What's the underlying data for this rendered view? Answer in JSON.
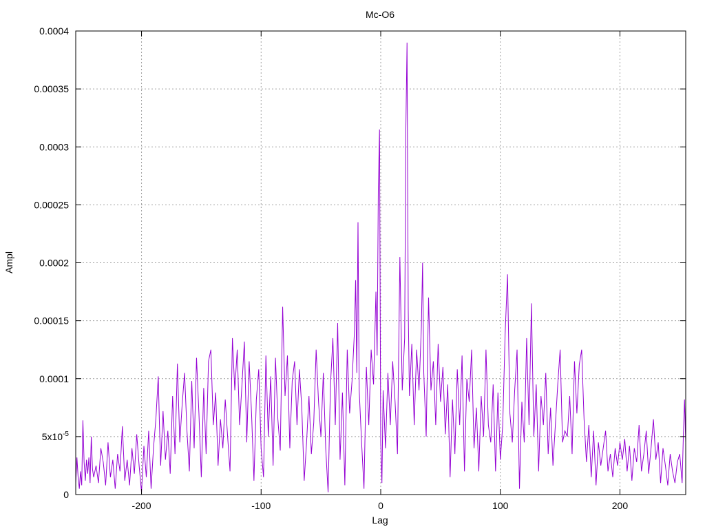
{
  "chart_data": {
    "type": "line",
    "title": "Mc-O6",
    "xlabel": "Lag",
    "ylabel": "Ampl",
    "xlim": [
      -255,
      255
    ],
    "ylim": [
      0,
      0.0004
    ],
    "grid": true,
    "legend": "none",
    "x_ticks": [
      {
        "value": -200,
        "label": "-200"
      },
      {
        "value": -100,
        "label": "-100"
      },
      {
        "value": 0,
        "label": "0"
      },
      {
        "value": 100,
        "label": "100"
      },
      {
        "value": 200,
        "label": "200"
      }
    ],
    "y_ticks": [
      {
        "value": 0,
        "label": "0"
      },
      {
        "value": 5e-05,
        "label": "5x10",
        "sup": "-5"
      },
      {
        "value": 0.0001,
        "label": "0.0001"
      },
      {
        "value": 0.00015,
        "label": "0.00015"
      },
      {
        "value": 0.0002,
        "label": "0.0002"
      },
      {
        "value": 0.00025,
        "label": "0.00025"
      },
      {
        "value": 0.0003,
        "label": "0.0003"
      },
      {
        "value": 0.00035,
        "label": "0.00035"
      },
      {
        "value": 0.0004,
        "label": "0.0004"
      }
    ],
    "series": [
      {
        "color": "#9400d3",
        "points": [
          [
            -255,
            1e-05
          ],
          [
            -254,
            3.2e-05
          ],
          [
            -253,
            1.5e-05
          ],
          [
            -252,
            5e-06
          ],
          [
            -251,
            2e-05
          ],
          [
            -250,
            8e-06
          ],
          [
            -249,
            6.4e-05
          ],
          [
            -248,
            2.8e-05
          ],
          [
            -247,
            1.2e-05
          ],
          [
            -246,
            3e-05
          ],
          [
            -245,
            1.8e-05
          ],
          [
            -244,
            3.2e-05
          ],
          [
            -243,
            1e-05
          ],
          [
            -242,
            5e-05
          ],
          [
            -241,
            2.2e-05
          ],
          [
            -240,
            1.5e-05
          ],
          [
            -238,
            2.5e-05
          ],
          [
            -236,
            1e-05
          ],
          [
            -234,
            4e-05
          ],
          [
            -232,
            2.8e-05
          ],
          [
            -230,
            8e-06
          ],
          [
            -228,
            4.5e-05
          ],
          [
            -226,
            1.5e-05
          ],
          [
            -224,
            3e-05
          ],
          [
            -222,
            5e-06
          ],
          [
            -220,
            3.5e-05
          ],
          [
            -218,
            2e-05
          ],
          [
            -216,
            5.9e-05
          ],
          [
            -214,
            1.2e-05
          ],
          [
            -212,
            3e-05
          ],
          [
            -210,
            8e-06
          ],
          [
            -208,
            4e-05
          ],
          [
            -206,
            1.8e-05
          ],
          [
            -204,
            5.2e-05
          ],
          [
            -202,
            2.5e-05
          ],
          [
            -200,
            2e-06
          ],
          [
            -198,
            4.2e-05
          ],
          [
            -196,
            1.5e-05
          ],
          [
            -194,
            5.5e-05
          ],
          [
            -192,
            5e-06
          ],
          [
            -190,
            4e-05
          ],
          [
            -188,
            6.5e-05
          ],
          [
            -186,
            0.000102
          ],
          [
            -185,
            6e-05
          ],
          [
            -184,
            2.5e-05
          ],
          [
            -182,
            7.2e-05
          ],
          [
            -180,
            3e-05
          ],
          [
            -178,
            5.5e-05
          ],
          [
            -176,
            1.8e-05
          ],
          [
            -174,
            8.5e-05
          ],
          [
            -172,
            3.5e-05
          ],
          [
            -170,
            0.000113
          ],
          [
            -168,
            4.5e-05
          ],
          [
            -166,
            7.8e-05
          ],
          [
            -164,
            0.000105
          ],
          [
            -162,
            5.5e-05
          ],
          [
            -160,
            2e-05
          ],
          [
            -158,
            9.8e-05
          ],
          [
            -156,
            4e-05
          ],
          [
            -154,
            0.000118
          ],
          [
            -152,
            7e-05
          ],
          [
            -150,
            1.5e-05
          ],
          [
            -148,
            9.2e-05
          ],
          [
            -146,
            3.5e-05
          ],
          [
            -144,
            0.000115
          ],
          [
            -142,
            0.000125
          ],
          [
            -140,
            6e-05
          ],
          [
            -138,
            8.8e-05
          ],
          [
            -136,
            2.5e-05
          ],
          [
            -134,
            6.5e-05
          ],
          [
            -132,
            4e-05
          ],
          [
            -130,
            8.2e-05
          ],
          [
            -128,
            5e-05
          ],
          [
            -126,
            2e-05
          ],
          [
            -124,
            0.000135
          ],
          [
            -122,
            9e-05
          ],
          [
            -120,
            0.000125
          ],
          [
            -118,
            6e-05
          ],
          [
            -116,
            9.5e-05
          ],
          [
            -114,
            0.000132
          ],
          [
            -112,
            4.5e-05
          ],
          [
            -110,
            0.000115
          ],
          [
            -108,
            7e-05
          ],
          [
            -106,
            1.2e-05
          ],
          [
            -104,
            8.2e-05
          ],
          [
            -102,
            0.000108
          ],
          [
            -100,
            4e-05
          ],
          [
            -98,
            1.5e-05
          ],
          [
            -96,
            0.00012
          ],
          [
            -94,
            5e-05
          ],
          [
            -92,
            0.000102
          ],
          [
            -90,
            2.5e-05
          ],
          [
            -88,
            0.000118
          ],
          [
            -86,
            6.5e-05
          ],
          [
            -84,
            3.8e-05
          ],
          [
            -82,
            0.000162
          ],
          [
            -80,
            8.5e-05
          ],
          [
            -78,
            0.00012
          ],
          [
            -76,
            4e-05
          ],
          [
            -74,
            9.8e-05
          ],
          [
            -72,
            0.000115
          ],
          [
            -70,
            6e-05
          ],
          [
            -68,
            0.000108
          ],
          [
            -66,
            7.5e-05
          ],
          [
            -64,
            1.2e-05
          ],
          [
            -62,
            4.5e-05
          ],
          [
            -60,
            8.5e-05
          ],
          [
            -58,
            3.5e-05
          ],
          [
            -56,
            6.2e-05
          ],
          [
            -54,
            0.000125
          ],
          [
            -52,
            8e-05
          ],
          [
            -50,
            5e-05
          ],
          [
            -48,
            0.000105
          ],
          [
            -46,
            4e-05
          ],
          [
            -44,
            2e-06
          ],
          [
            -42,
            9.5e-05
          ],
          [
            -40,
            0.000135
          ],
          [
            -38,
            6e-05
          ],
          [
            -36,
            0.000148
          ],
          [
            -34,
            3e-05
          ],
          [
            -32,
            8.8e-05
          ],
          [
            -30,
            8e-06
          ],
          [
            -28,
            0.000125
          ],
          [
            -26,
            7e-05
          ],
          [
            -24,
            9.8e-05
          ],
          [
            -22,
            0.00014
          ],
          [
            -21,
            0.000185
          ],
          [
            -20,
            0.000105
          ],
          [
            -19,
            0.000235
          ],
          [
            -18,
            9e-05
          ],
          [
            -16,
            4.5e-05
          ],
          [
            -14,
            5e-06
          ],
          [
            -12,
            0.00011
          ],
          [
            -10,
            6e-05
          ],
          [
            -8,
            0.000125
          ],
          [
            -6,
            9.5e-05
          ],
          [
            -4,
            0.000175
          ],
          [
            -3,
            0.00012
          ],
          [
            -2,
            0.000265
          ],
          [
            -1,
            0.000315
          ],
          [
            0,
            4.5e-05
          ],
          [
            1,
            1e-05
          ],
          [
            2,
            9e-05
          ],
          [
            4,
            4e-05
          ],
          [
            6,
            0.000105
          ],
          [
            8,
            6e-05
          ],
          [
            10,
            0.000115
          ],
          [
            12,
            8e-05
          ],
          [
            14,
            3.5e-05
          ],
          [
            16,
            0.000205
          ],
          [
            18,
            9e-05
          ],
          [
            20,
            0.000135
          ],
          [
            21,
            0.000315
          ],
          [
            22,
            0.00039
          ],
          [
            23,
            0.00016
          ],
          [
            24,
            8.5e-05
          ],
          [
            26,
            0.00013
          ],
          [
            28,
            6e-05
          ],
          [
            30,
            0.000125
          ],
          [
            32,
            9e-05
          ],
          [
            34,
            0.000145
          ],
          [
            35,
            0.0002
          ],
          [
            36,
            0.000105
          ],
          [
            38,
            5e-05
          ],
          [
            40,
            0.00017
          ],
          [
            42,
            9e-05
          ],
          [
            44,
            0.000115
          ],
          [
            46,
            6e-05
          ],
          [
            48,
            0.00013
          ],
          [
            50,
            8e-05
          ],
          [
            52,
            0.00011
          ],
          [
            54,
            5.2e-05
          ],
          [
            56,
            9.5e-05
          ],
          [
            58,
            1.5e-05
          ],
          [
            60,
            8.2e-05
          ],
          [
            62,
            3.5e-05
          ],
          [
            64,
            0.000108
          ],
          [
            66,
            6e-05
          ],
          [
            68,
            0.00012
          ],
          [
            70,
            2e-05
          ],
          [
            72,
            0.0001
          ],
          [
            74,
            8e-05
          ],
          [
            76,
            0.000125
          ],
          [
            78,
            4e-05
          ],
          [
            80,
            7.5e-05
          ],
          [
            82,
            2e-05
          ],
          [
            84,
            8.5e-05
          ],
          [
            86,
            5e-05
          ],
          [
            88,
            0.000125
          ],
          [
            90,
            6e-05
          ],
          [
            92,
            4.5e-05
          ],
          [
            94,
            9.5e-05
          ],
          [
            96,
            2e-05
          ],
          [
            98,
            8.8e-05
          ],
          [
            100,
            3e-05
          ],
          [
            102,
            6e-05
          ],
          [
            104,
            0.000138
          ],
          [
            106,
            0.00019
          ],
          [
            108,
            7e-05
          ],
          [
            110,
            4.5e-05
          ],
          [
            112,
            9e-05
          ],
          [
            114,
            0.000125
          ],
          [
            116,
            5e-06
          ],
          [
            118,
            8e-05
          ],
          [
            120,
            4.5e-05
          ],
          [
            122,
            0.000135
          ],
          [
            124,
            6e-05
          ],
          [
            126,
            0.000165
          ],
          [
            128,
            5e-05
          ],
          [
            130,
            9.5e-05
          ],
          [
            132,
            2e-05
          ],
          [
            134,
            8.5e-05
          ],
          [
            136,
            6e-05
          ],
          [
            138,
            0.000105
          ],
          [
            140,
            3.5e-05
          ],
          [
            142,
            7.5e-05
          ],
          [
            144,
            2.5e-05
          ],
          [
            146,
            6e-05
          ],
          [
            148,
            9.5e-05
          ],
          [
            150,
            0.000125
          ],
          [
            152,
            4.5e-05
          ],
          [
            154,
            5.5e-05
          ],
          [
            156,
            5e-05
          ],
          [
            158,
            8.5e-05
          ],
          [
            160,
            3.5e-05
          ],
          [
            162,
            0.000115
          ],
          [
            164,
            7e-05
          ],
          [
            166,
            0.000112
          ],
          [
            168,
            0.000125
          ],
          [
            170,
            6.5e-05
          ],
          [
            172,
            2.8e-05
          ],
          [
            174,
            6e-05
          ],
          [
            176,
            1.5e-05
          ],
          [
            178,
            5.5e-05
          ],
          [
            180,
            8e-06
          ],
          [
            182,
            4.5e-05
          ],
          [
            184,
            2.5e-05
          ],
          [
            186,
            4e-05
          ],
          [
            188,
            5.5e-05
          ],
          [
            190,
            2e-05
          ],
          [
            192,
            3.5e-05
          ],
          [
            194,
            1.5e-05
          ],
          [
            196,
            4e-05
          ],
          [
            198,
            2.5e-05
          ],
          [
            200,
            4.5e-05
          ],
          [
            202,
            3e-05
          ],
          [
            204,
            4.8e-05
          ],
          [
            206,
            2e-05
          ],
          [
            208,
            4.2e-05
          ],
          [
            210,
            1.2e-05
          ],
          [
            212,
            4e-05
          ],
          [
            214,
            2.8e-05
          ],
          [
            216,
            6e-05
          ],
          [
            218,
            2e-05
          ],
          [
            220,
            3.5e-05
          ],
          [
            222,
            5.5e-05
          ],
          [
            224,
            1.8e-05
          ],
          [
            226,
            4e-05
          ],
          [
            228,
            6.5e-05
          ],
          [
            230,
            3e-05
          ],
          [
            232,
            4.5e-05
          ],
          [
            234,
            1e-05
          ],
          [
            236,
            4e-05
          ],
          [
            238,
            2.5e-05
          ],
          [
            240,
            8e-06
          ],
          [
            242,
            3.5e-05
          ],
          [
            244,
            2e-05
          ],
          [
            246,
            1e-05
          ],
          [
            248,
            2.8e-05
          ],
          [
            250,
            3.5e-05
          ],
          [
            252,
            1e-05
          ],
          [
            253,
            5e-05
          ],
          [
            254,
            8.2e-05
          ],
          [
            255,
            4.5e-05
          ]
        ]
      }
    ]
  }
}
